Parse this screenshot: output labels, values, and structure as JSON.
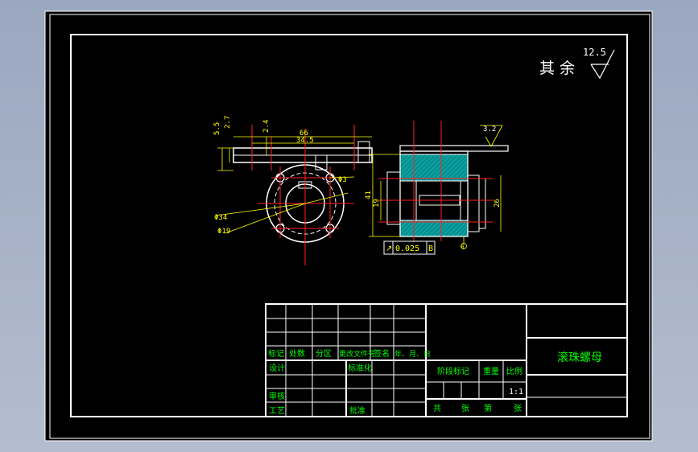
{
  "drawing": {
    "surface_finish_note": {
      "label": "其 余",
      "value": "12.5"
    },
    "top_view_dims": {
      "overall_width": "66",
      "hole_spacing": "34.5",
      "left_a": "5.5",
      "left_b": "2.7",
      "mid": "2.4",
      "small_hole": "Φ3",
      "outer_dia": "Φ34",
      "inner_dia": "Φ19"
    },
    "section_view_dims": {
      "roughness": "3.2",
      "height_a": "41",
      "height_b": "19",
      "right_height": "26",
      "datum": "B"
    },
    "tolerance_frame": {
      "symbol": "↗",
      "value": "0.025",
      "datum": "B"
    },
    "title_block": {
      "rev_headers": [
        "标记",
        "处数",
        "分区",
        "更改文件号",
        "签名",
        "年、月、日"
      ],
      "row_labels": {
        "design": "设计",
        "standard": "标准化",
        "review": "审核",
        "process": "工艺",
        "approve": "批准"
      },
      "stage_label": "阶段标记",
      "weight_label": "重量",
      "scale_label": "比例",
      "scale": "1:1",
      "part_name": "滚珠螺母",
      "sheets": {
        "total_prefix": "共",
        "total_suffix": "张",
        "current_prefix": "第",
        "current_suffix": "张"
      }
    }
  },
  "colors": {
    "background": "#000000",
    "outline": "#ffffff",
    "dim_text": "#ffff00",
    "center_line": "#ff0000",
    "section_fill": "#009a9a",
    "title_text": "#00ff00",
    "hidden": "#00ffff"
  }
}
